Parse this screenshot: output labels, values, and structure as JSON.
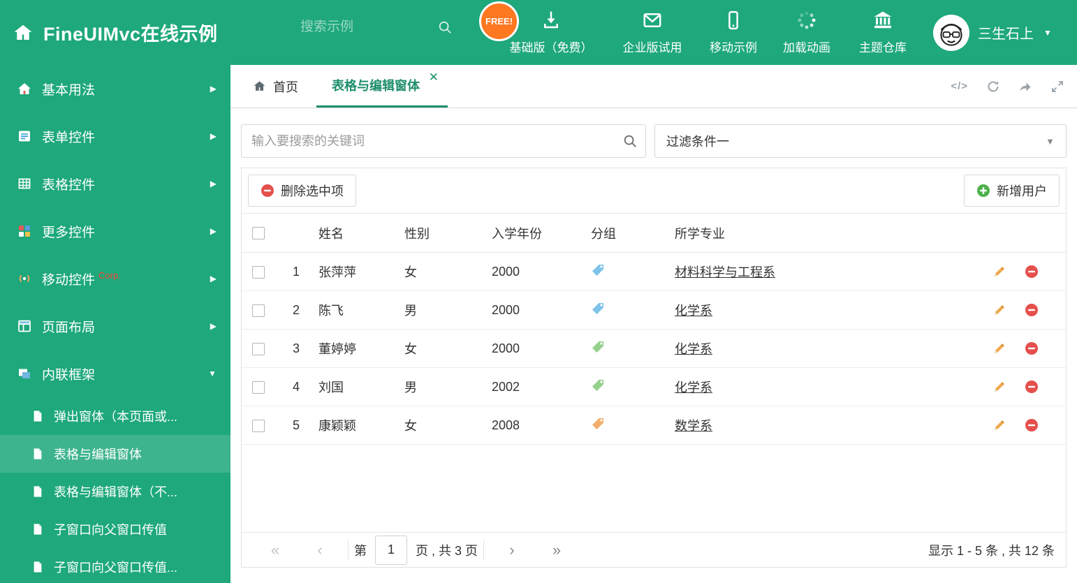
{
  "colors": {
    "brand_green": "#1EA87C",
    "active_tab": "#1E8E6E",
    "free_badge_bg": "#FD7821",
    "delete_red": "#E5504C",
    "add_green": "#4DB04A",
    "edit_orange": "#F0A74C"
  },
  "header": {
    "title": "FineUIMvc在线示例",
    "search_placeholder": "搜索示例",
    "free_badge": "FREE!",
    "nav": [
      {
        "label": "基础版（免费）"
      },
      {
        "label": "企业版试用"
      },
      {
        "label": "移动示例"
      },
      {
        "label": "加载动画"
      },
      {
        "label": "主题仓库"
      }
    ],
    "user_name": "三生石上"
  },
  "sidebar": {
    "items": [
      {
        "label": "基本用法"
      },
      {
        "label": "表单控件"
      },
      {
        "label": "表格控件"
      },
      {
        "label": "更多控件"
      },
      {
        "label": "移动控件",
        "badge": "Corp."
      },
      {
        "label": "页面布局"
      },
      {
        "label": "内联框架"
      }
    ],
    "subitems": [
      {
        "label": "弹出窗体（本页面或..."
      },
      {
        "label": "表格与编辑窗体"
      },
      {
        "label": "表格与编辑窗体（不..."
      },
      {
        "label": "子窗口向父窗口传值"
      },
      {
        "label": "子窗口向父窗口传值..."
      }
    ]
  },
  "tabs": {
    "home": "首页",
    "active": "表格与编辑窗体"
  },
  "filter": {
    "search_placeholder": "输入要搜索的关键词",
    "dropdown_value": "过滤条件一"
  },
  "toolbar": {
    "delete_label": "删除选中项",
    "add_label": "新增用户"
  },
  "table": {
    "headers": {
      "name": "姓名",
      "gender": "性别",
      "year": "入学年份",
      "group": "分组",
      "major": "所学专业"
    },
    "rows": [
      {
        "num": "1",
        "name": "张萍萍",
        "gender": "女",
        "year": "2000",
        "tag_color": "#7EC3EA",
        "major": "材料科学与工程系"
      },
      {
        "num": "2",
        "name": "陈飞",
        "gender": "男",
        "year": "2000",
        "tag_color": "#7EC3EA",
        "major": "化学系"
      },
      {
        "num": "3",
        "name": "董婷婷",
        "gender": "女",
        "year": "2000",
        "tag_color": "#95D08D",
        "major": "化学系"
      },
      {
        "num": "4",
        "name": "刘国",
        "gender": "男",
        "year": "2002",
        "tag_color": "#95D08D",
        "major": "化学系"
      },
      {
        "num": "5",
        "name": "康颖颖",
        "gender": "女",
        "year": "2008",
        "tag_color": "#F2AF6E",
        "major": "数学系"
      }
    ]
  },
  "pagination": {
    "prefix": "第",
    "page": "1",
    "suffix": "页 , 共 3 页",
    "summary": "显示 1 - 5 条 , 共 12 条"
  }
}
